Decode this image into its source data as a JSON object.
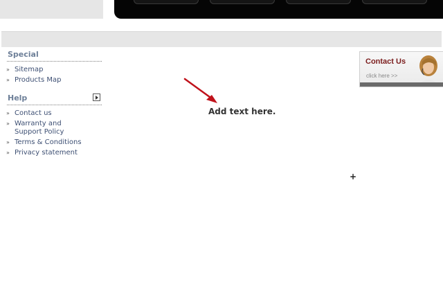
{
  "sidebar": {
    "special": {
      "title": "Special",
      "items": [
        "Sitemap",
        "Products Map"
      ]
    },
    "help": {
      "title": "Help",
      "items": [
        "Contact us",
        "Warranty and Support Policy",
        "Terms & Conditions",
        "Privacy statement"
      ]
    }
  },
  "main": {
    "placeholder_text": "Add text here.",
    "plus_glyph": "+"
  },
  "contact_banner": {
    "title": "Contact Us",
    "link_text": "click here >>"
  },
  "colors": {
    "section_title": "#6d7f98",
    "link": "#3d4f73",
    "arrow": "#c0121b",
    "banner_title": "#7a1c1c"
  }
}
